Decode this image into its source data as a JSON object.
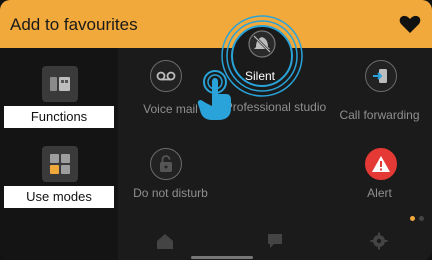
{
  "header": {
    "title": "Add to favourites",
    "heart_icon": "heart-icon"
  },
  "sidebar": {
    "items": [
      {
        "label": "Functions",
        "icon": "functions-icon"
      },
      {
        "label": "Use modes",
        "icon": "use-modes-icon"
      }
    ]
  },
  "grid": {
    "items": [
      {
        "label": "Voice mail",
        "icon": "voicemail-icon"
      },
      {
        "label": "Silent",
        "icon": "silent-icon",
        "highlighted": true
      },
      {
        "label": "Professional studio",
        "icon": "professional-studio-icon"
      },
      {
        "label": "Call forwarding",
        "icon": "call-forwarding-icon"
      },
      {
        "label": "Do not disturb",
        "icon": "do-not-disturb-icon"
      },
      {
        "label": "Alert",
        "icon": "alert-icon"
      }
    ]
  },
  "bottom_bar": {
    "icons": [
      "home-icon",
      "message-icon",
      "settings-icon"
    ]
  },
  "pagination": {
    "pages": 2,
    "active": 1
  },
  "colors": {
    "accent": "#f2a93b",
    "touch_blue": "#29a3d9",
    "alert_red": "#e53935"
  }
}
